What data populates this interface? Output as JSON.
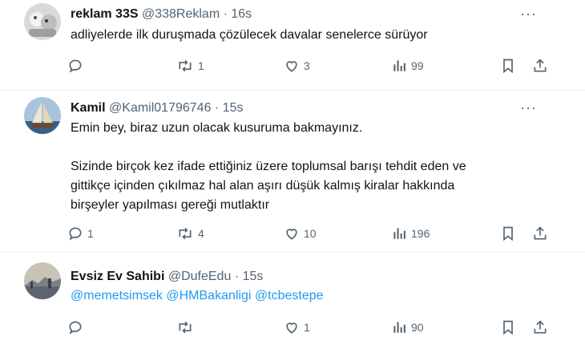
{
  "tweets": [
    {
      "name": "reklam 33S",
      "handle": "@338Reklam",
      "dot": "·",
      "time": "16s",
      "text": "adliyelerde ilk duruşmada çözülecek davalar senelerce sürüyor",
      "replies": "",
      "retweets": "1",
      "likes": "3",
      "views": "99"
    },
    {
      "name": "Kamil",
      "handle": "@Kamil01796746",
      "dot": "·",
      "time": "15s",
      "text_p1": "Emin bey, biraz uzun olacak kusuruma bakmayınız.",
      "text_p2_l1": "Sizinde birçok kez ifade ettiğiniz üzere toplumsal barışı tehdit eden ve",
      "text_p2_l2": "gittikçe içinden çıkılmaz hal alan aşırı düşük kalmış kiralar hakkında",
      "text_p2_l3": "birşeyler yapılması gereği mutlaktır",
      "replies": "1",
      "retweets": "4",
      "likes": "10",
      "views": "196"
    },
    {
      "name": "Evsiz Ev Sahibi",
      "handle": "@DufeEdu",
      "dot": "·",
      "time": "15s",
      "mentions": [
        "@memetsimsek",
        "@HMBakanligi",
        "@tcbestepe"
      ],
      "replies": "",
      "retweets": "",
      "likes": "1",
      "views": "90"
    }
  ],
  "more_label": "···",
  "colors": {
    "text": "#0f1419",
    "secondary": "#536471",
    "link": "#1d9bf0",
    "divider": "#eff3f4"
  },
  "icons": [
    "reply-icon",
    "retweet-icon",
    "like-icon",
    "views-icon",
    "bookmark-icon",
    "share-icon",
    "more-icon"
  ]
}
